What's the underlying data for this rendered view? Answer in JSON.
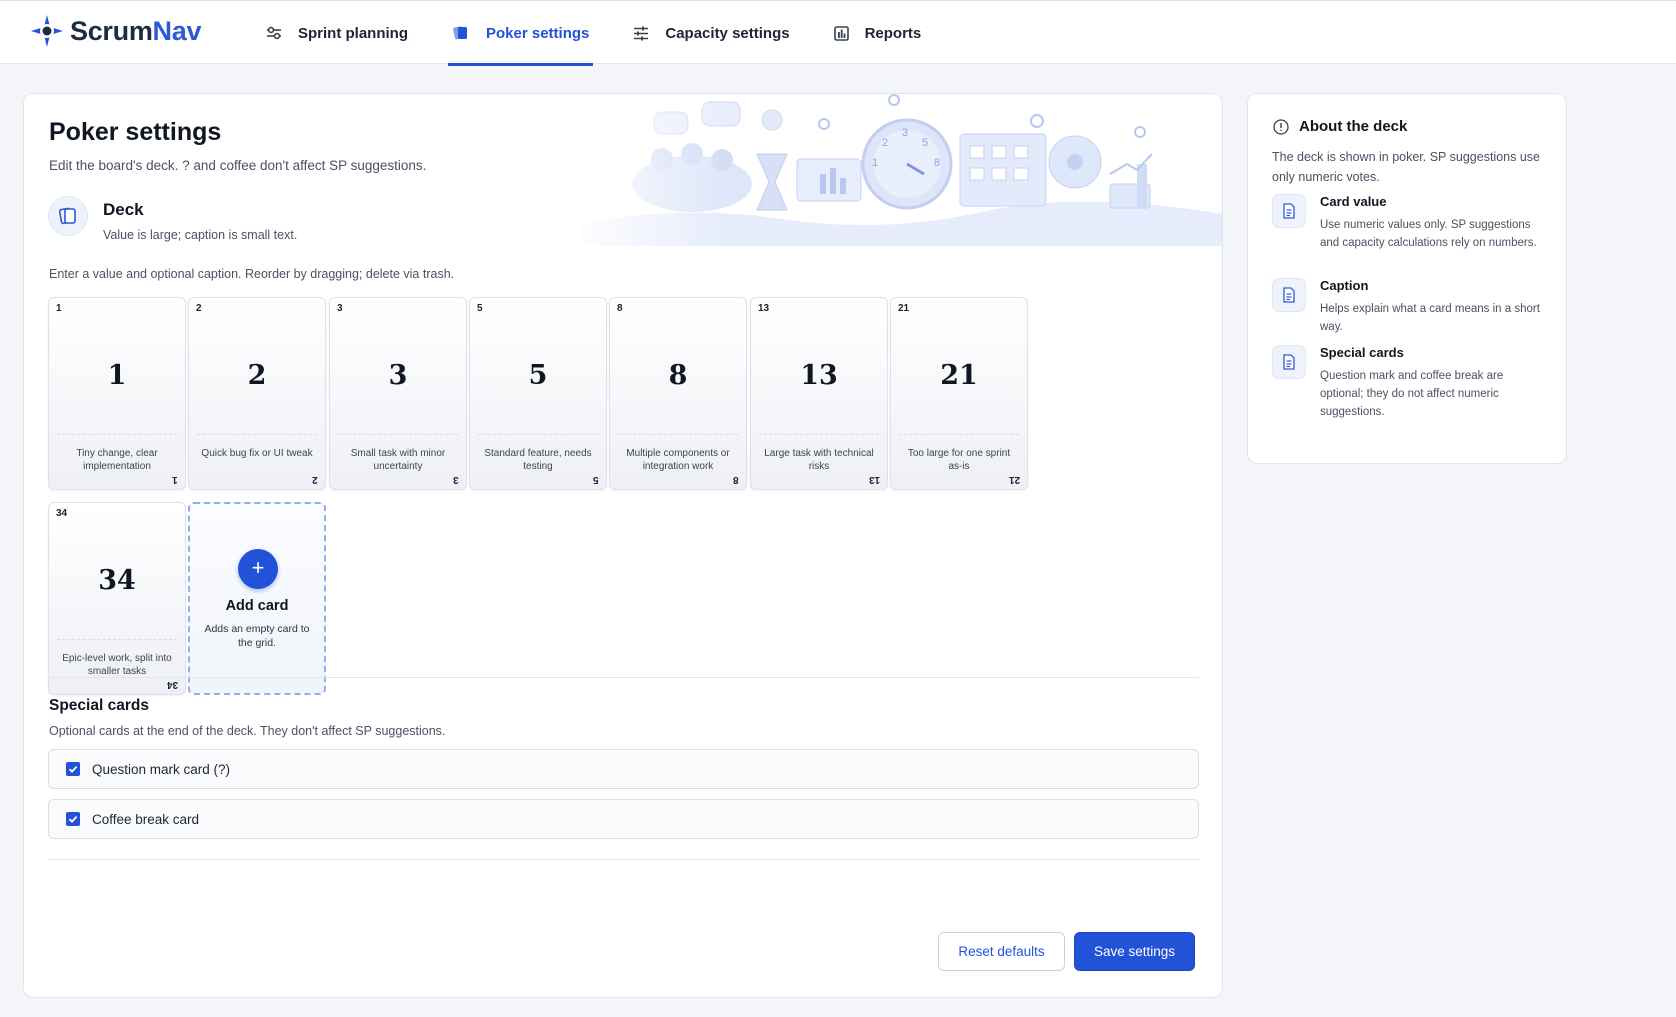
{
  "app": {
    "name_part1": "Scrum",
    "name_part2": "Nav"
  },
  "nav": {
    "items": [
      {
        "label": "Sprint planning",
        "icon": "sliders-icon",
        "active": false
      },
      {
        "label": "Poker settings",
        "icon": "cards-icon",
        "active": true
      },
      {
        "label": "Capacity settings",
        "icon": "tune-icon",
        "active": false
      },
      {
        "label": "Reports",
        "icon": "bar-chart-icon",
        "active": false
      }
    ]
  },
  "page": {
    "title": "Poker settings",
    "subtitle": "Edit the board's deck. ? and coffee don't affect SP suggestions."
  },
  "deck": {
    "title": "Deck",
    "subtitle": "Value is large; caption is small text.",
    "help": "Enter a value and optional caption. Reorder by dragging; delete via trash.",
    "cards": [
      {
        "value": "1",
        "caption": "Tiny change, clear implementation"
      },
      {
        "value": "2",
        "caption": "Quick bug fix or UI tweak"
      },
      {
        "value": "3",
        "caption": "Small task with minor uncertainty"
      },
      {
        "value": "5",
        "caption": "Standard feature, needs testing"
      },
      {
        "value": "8",
        "caption": "Multiple components or integration work"
      },
      {
        "value": "13",
        "caption": "Large task with technical risks"
      },
      {
        "value": "21",
        "caption": "Too large for one sprint as-is"
      },
      {
        "value": "34",
        "caption": "Epic-level work, split into smaller tasks"
      }
    ],
    "add_card": {
      "title": "Add card",
      "subtitle": "Adds an empty card to the grid.",
      "icon": "plus-icon"
    }
  },
  "special": {
    "title": "Special cards",
    "subtitle": "Optional cards at the end of the deck. They don't affect SP suggestions.",
    "options": [
      {
        "label": "Question mark card (?)",
        "checked": true
      },
      {
        "label": "Coffee break card",
        "checked": true
      }
    ]
  },
  "actions": {
    "reset": "Reset defaults",
    "save": "Save settings"
  },
  "aside": {
    "title": "About the deck",
    "description": "The deck is shown in poker. SP suggestions use only numeric votes.",
    "items": [
      {
        "title": "Card value",
        "text": "Use numeric values only. SP suggestions and capacity calculations rely on numbers.",
        "icon": "document-icon"
      },
      {
        "title": "Caption",
        "text": "Helps explain what a card means in a short way.",
        "icon": "document-icon"
      },
      {
        "title": "Special cards",
        "text": "Question mark and coffee break are optional; they do not affect numeric suggestions.",
        "icon": "document-icon"
      }
    ]
  },
  "colors": {
    "accent": "#2152d8",
    "brand_dark": "#1f2a44",
    "border": "#e1e5ed",
    "background": "#f3f5f9"
  }
}
